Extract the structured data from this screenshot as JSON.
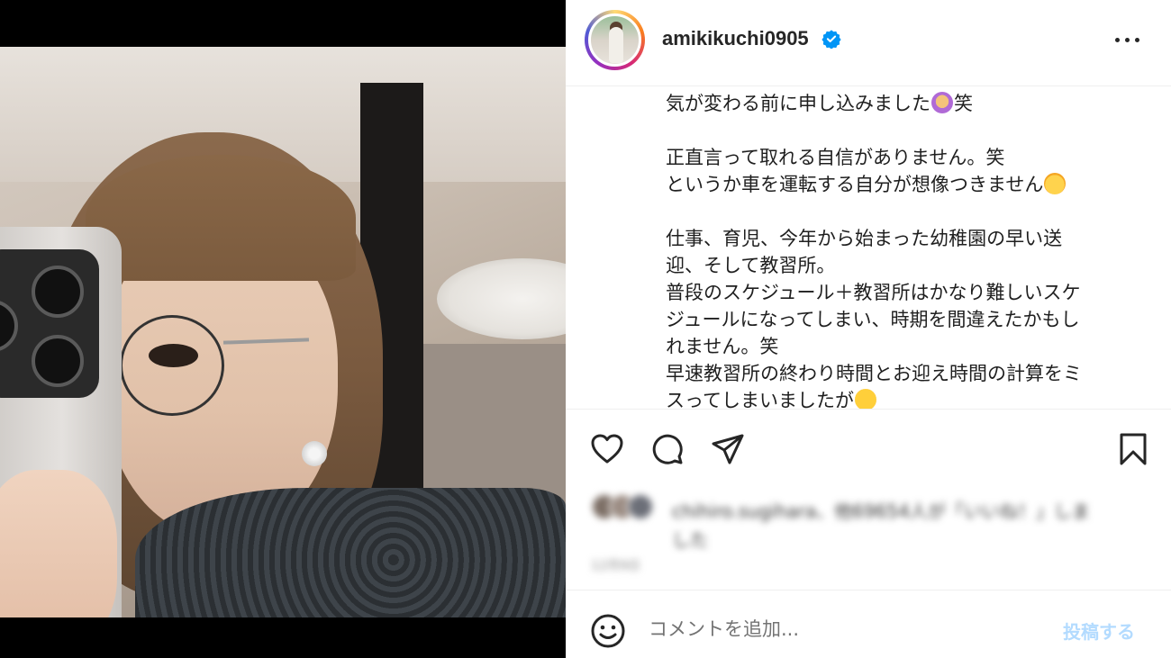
{
  "post": {
    "username": "amikikuchi0905",
    "verified": true,
    "caption_lines": [
      {
        "text": "気が変わる前に申し込みました",
        "emoji": "person-gesturing-no",
        "suffix": "笑"
      },
      {
        "gap": true
      },
      {
        "text": "正直言って取れる自信がありません。笑"
      },
      {
        "text": "というか車を運転する自分が想像つきません",
        "emoji": "exploding-head"
      },
      {
        "gap": true
      },
      {
        "text": "仕事、育児、今年から始まった幼稚園の早い送"
      },
      {
        "text": "迎、そして教習所。"
      },
      {
        "text": "普段のスケジュール＋教習所はかなり難しいスケ"
      },
      {
        "text": "ジュールになってしまい、時期を間違えたかもし"
      },
      {
        "text": "れません。笑"
      },
      {
        "text": "早速教習所の終わり時間とお迎え時間の計算をミ"
      },
      {
        "text": "スってしまいましたが",
        "emoji": "face-with-tears-of-joy"
      }
    ]
  },
  "likes": {
    "line1": "chihiro.sugihara、他69654人が「いいね！」しま",
    "line2": "した",
    "date": "12月9日"
  },
  "comment": {
    "placeholder": "コメントを追加...",
    "post_label": "投稿する"
  },
  "icons": {
    "like": "heart-icon",
    "comment": "comment-icon",
    "share": "paper-plane-icon",
    "save": "bookmark-icon",
    "emoji": "smiley-icon",
    "more": "more-horizontal-icon",
    "verified": "verified-badge-icon"
  },
  "colors": {
    "verified": "#0095f6",
    "post_button_disabled": "#b3dbff"
  }
}
